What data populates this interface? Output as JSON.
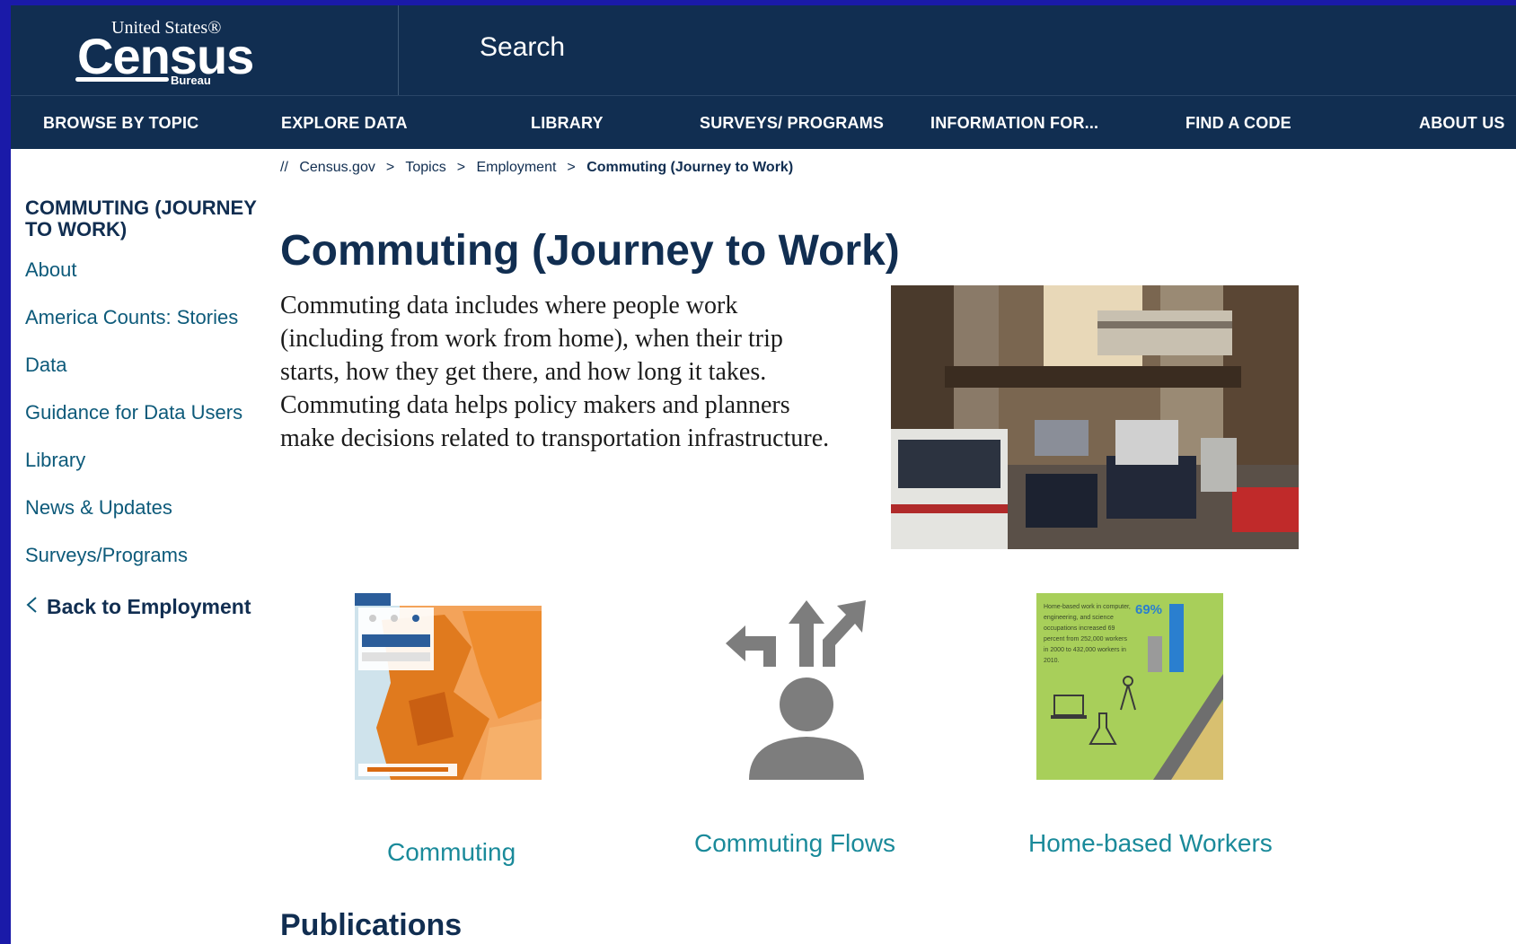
{
  "header": {
    "logo": {
      "top_text": "United States®",
      "main_text": "Census",
      "sub_text": "Bureau"
    },
    "search_label": "Search"
  },
  "nav": [
    {
      "label": "BROWSE BY TOPIC"
    },
    {
      "label": "EXPLORE DATA"
    },
    {
      "label": "LIBRARY"
    },
    {
      "label": "SURVEYS/ PROGRAMS"
    },
    {
      "label": "INFORMATION FOR..."
    },
    {
      "label": "FIND A CODE"
    },
    {
      "label": "ABOUT US"
    }
  ],
  "breadcrumb": {
    "root": "//",
    "items": [
      "Census.gov",
      "Topics",
      "Employment"
    ],
    "separator": ">",
    "current": "Commuting (Journey to Work)"
  },
  "sidebar": {
    "heading": "COMMUTING (JOURNEY TO WORK)",
    "items": [
      {
        "label": "About"
      },
      {
        "label": "America Counts: Stories"
      },
      {
        "label": "Data"
      },
      {
        "label": "Guidance for Data Users"
      },
      {
        "label": "Library"
      },
      {
        "label": "News & Updates"
      },
      {
        "label": "Surveys/Programs"
      }
    ],
    "back_label": "Back to Employment"
  },
  "main": {
    "title": "Commuting (Journey to Work)",
    "intro": "Commuting data includes where people work (including from work from home), when their trip starts, how they get there, and how long it takes. Commuting data helps policy makers and planners make decisions related to transportation infrastructure.",
    "cards": [
      {
        "label": "Commuting",
        "icon": "map-thumbnail"
      },
      {
        "label": "Commuting Flows",
        "icon": "person-arrows-icon"
      },
      {
        "label": "Home-based Workers",
        "icon": "infographic-thumbnail",
        "infographic_text": "Home-based work in computer, engineering, and science occupations increased 69 percent from 252,000 workers in 2000 to 432,000 workers in 2010.",
        "infographic_percent": "69%"
      }
    ],
    "publications_heading": "Publications"
  },
  "colors": {
    "navy": "#112e51",
    "teal_link": "#1a8a9a",
    "link": "#0d5a7a",
    "frame_border": "#1a1aa8"
  }
}
